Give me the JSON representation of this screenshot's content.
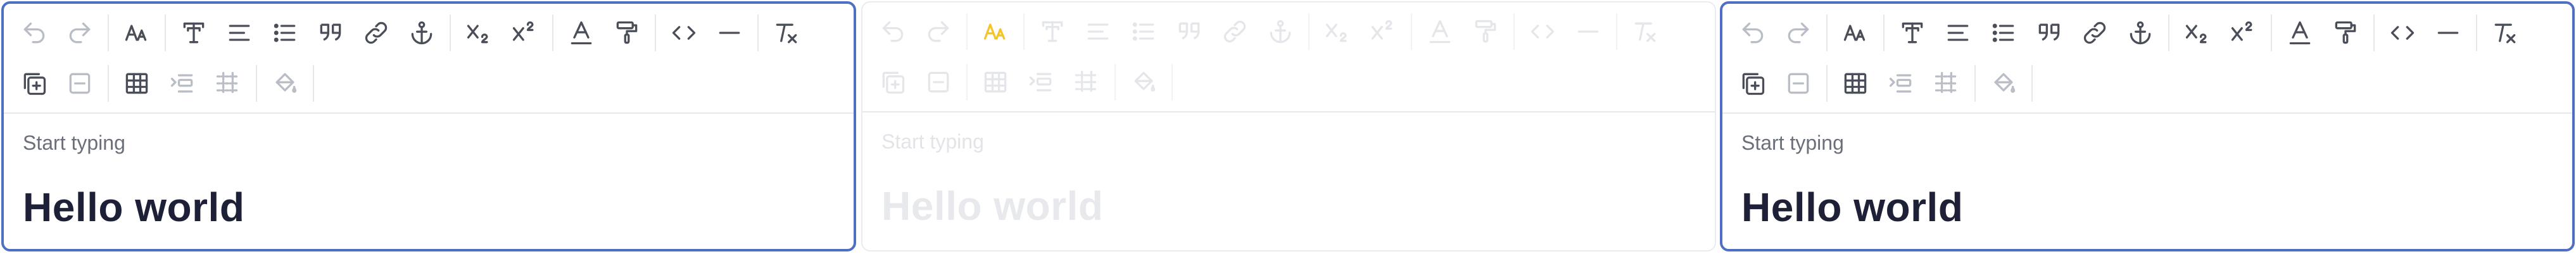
{
  "editors": [
    {
      "id": "editor-1",
      "state": "focused",
      "placeholder": "Start typing",
      "heading": "Hello world"
    },
    {
      "id": "editor-2",
      "state": "disabled",
      "placeholder": "Start typing",
      "heading": "Hello world"
    },
    {
      "id": "editor-3",
      "state": "focused",
      "placeholder": "Start typing",
      "heading": "Hello world"
    }
  ],
  "colors": {
    "focus_border": "#4f6fc4",
    "idle_border": "#e9ebef",
    "icon": "#4a4e58",
    "icon_disabled": "#b9bdc6",
    "highlight_icon": "#f3c52a",
    "heading": "#1d2036",
    "placeholder": "#6b6f7a"
  },
  "toolbar": {
    "row1": [
      "undo-icon",
      "redo-icon",
      "font-size-icon",
      "text-style-icon",
      "align-icon",
      "bullet-list-icon",
      "quote-icon",
      "link-icon",
      "anchor-icon",
      "subscript-icon",
      "superscript-icon",
      "text-color-icon",
      "format-painter-icon",
      "code-icon",
      "horizontal-rule-icon",
      "clear-format-icon"
    ],
    "row2": [
      "add-table-icon",
      "remove-icon",
      "table-icon",
      "indent-icon",
      "table-grid-icon",
      "fill-color-icon"
    ]
  }
}
